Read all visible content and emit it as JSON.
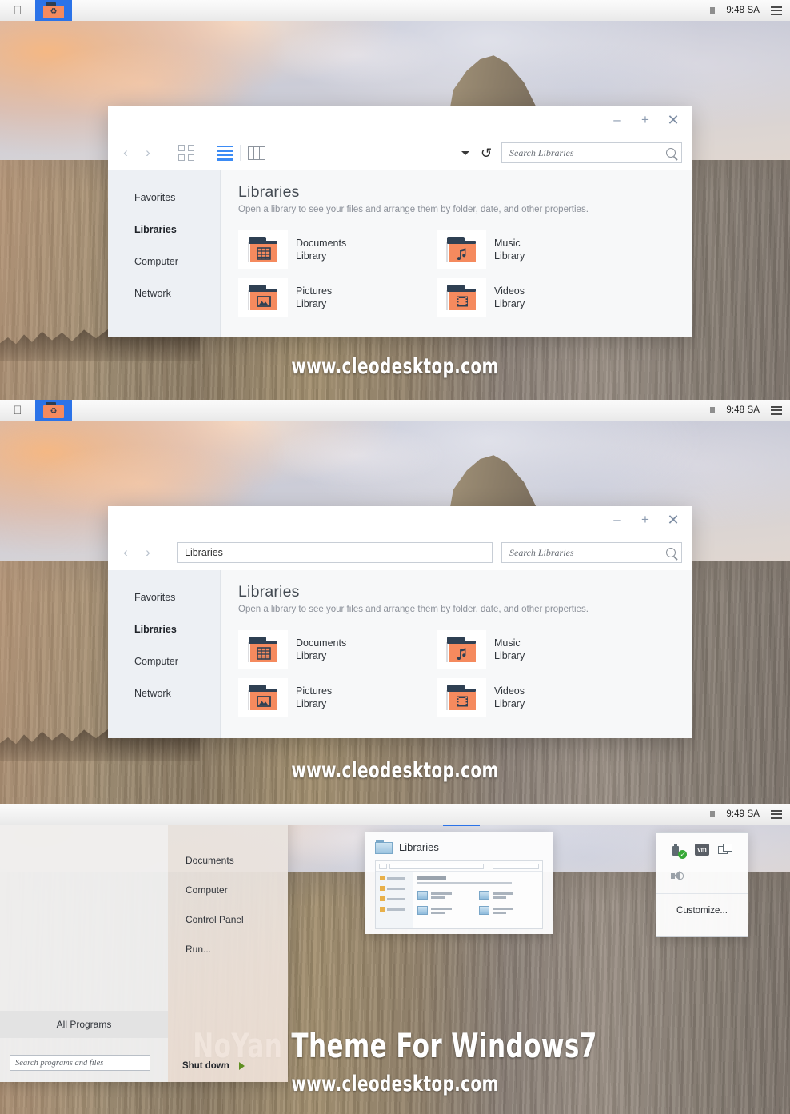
{
  "menubar": {
    "apple_icon": "apple-logo",
    "tile_icon": "recycle-bin-icon",
    "clock": "9:48 SA",
    "clock_third": "9:49 SA",
    "status_icon": "battery-indicator",
    "menu_icon": "list-menu-icon"
  },
  "window1": {
    "controls": {
      "minimize": "–",
      "maximize": "+",
      "close": "✕"
    },
    "toolbar": {
      "back_icon": "chevron-left-icon",
      "forward_icon": "chevron-right-icon",
      "view_grid_icon": "grid-view-icon",
      "view_list_icon": "list-view-icon",
      "view_column_icon": "column-view-icon",
      "caret_icon": "chevron-down-icon",
      "refresh_icon": "refresh-icon"
    },
    "search": {
      "placeholder": "Search Libraries",
      "icon": "search-icon"
    },
    "sidebar": {
      "items": [
        {
          "label": "Favorites",
          "active": false
        },
        {
          "label": "Libraries",
          "active": true
        },
        {
          "label": "Computer",
          "active": false
        },
        {
          "label": "Network",
          "active": false
        }
      ]
    },
    "content": {
      "title": "Libraries",
      "subtitle": "Open a library to see your files and arrange them by folder, date, and other properties.",
      "libraries": [
        {
          "name": "Documents",
          "kind": "Library",
          "icon": "documents-folder-icon",
          "glyph": "grid"
        },
        {
          "name": "Music",
          "kind": "Library",
          "icon": "music-folder-icon",
          "glyph": "note"
        },
        {
          "name": "Pictures",
          "kind": "Library",
          "icon": "pictures-folder-icon",
          "glyph": "image"
        },
        {
          "name": "Videos",
          "kind": "Library",
          "icon": "videos-folder-icon",
          "glyph": "film"
        }
      ]
    }
  },
  "window2": {
    "address": {
      "value": "Libraries"
    },
    "search": {
      "placeholder": "Search Libraries",
      "icon": "search-icon"
    }
  },
  "startmenu": {
    "right_items": [
      {
        "label": "Documents"
      },
      {
        "label": "Computer"
      },
      {
        "label": "Control Panel"
      },
      {
        "label": "Run..."
      }
    ],
    "all_programs": "All Programs",
    "search_placeholder": "Search programs and files",
    "shutdown": "Shut down",
    "shutdown_arrow_icon": "chevron-right-icon"
  },
  "thumbnail": {
    "title": "Libraries",
    "icon": "folder-icon"
  },
  "tray": {
    "icons": [
      {
        "name": "usb-device-icon"
      },
      {
        "name": "vm-icon",
        "label": "vm"
      },
      {
        "name": "network-icon"
      },
      {
        "name": "speaker-icon"
      }
    ],
    "customize": "Customize..."
  },
  "watermarks": {
    "site": "www.cleodesktop.com",
    "title": "NoYan Theme For Windows7"
  },
  "colors": {
    "accent_folder": "#f58a5e",
    "folder_dark": "#2f4053",
    "tile_blue": "#2b73e8",
    "list_active": "#3b8bf5",
    "sidebar_bg": "#edf0f4",
    "shutdown_arrow": "#5f8f22"
  }
}
